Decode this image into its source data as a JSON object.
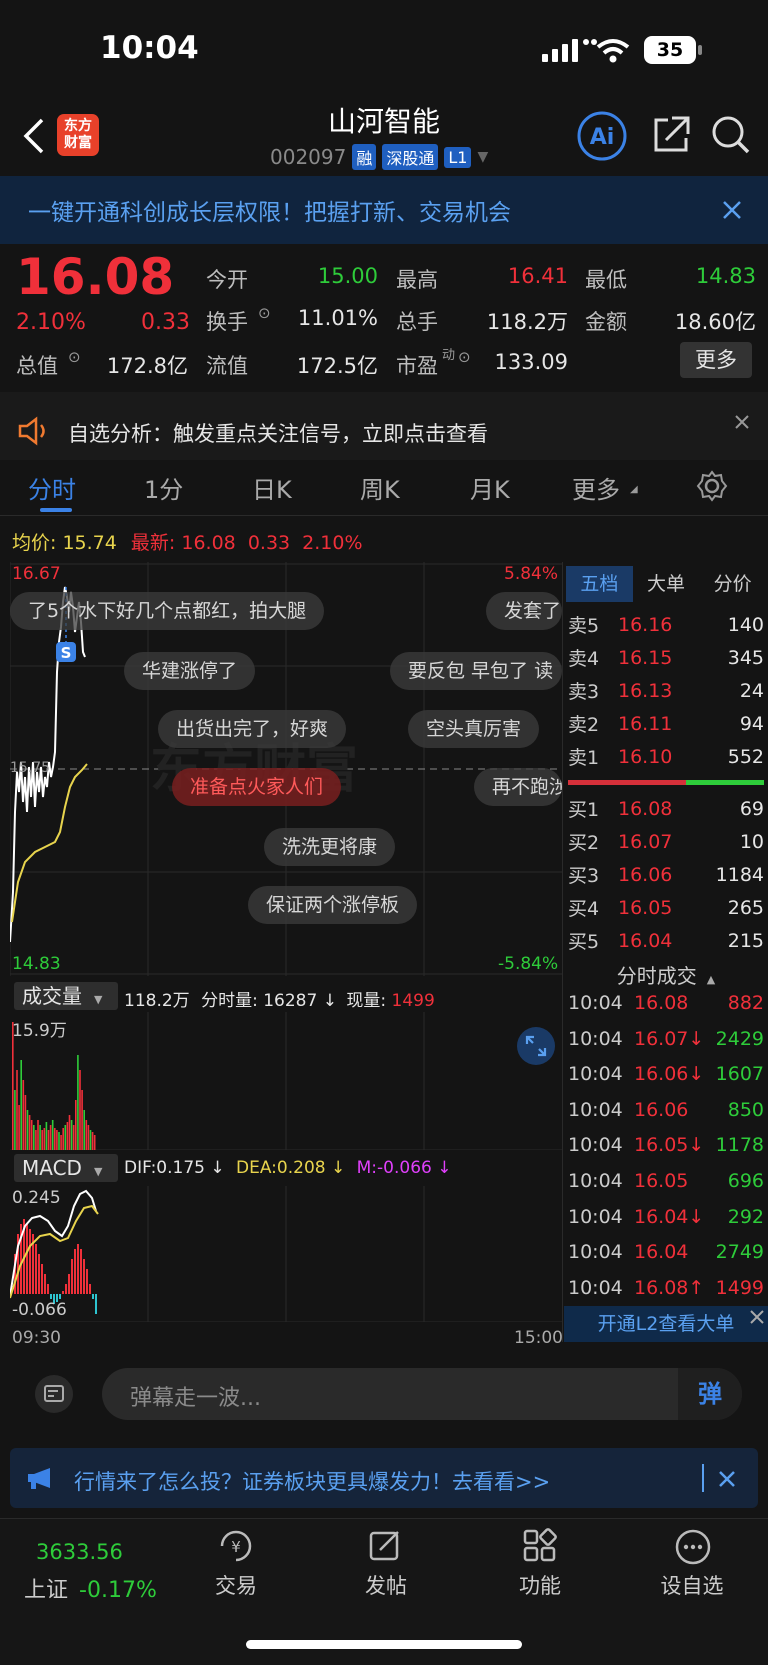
{
  "status": {
    "time": "10:04",
    "battery": "35"
  },
  "header": {
    "logo_line1": "东方",
    "logo_line2": "财富",
    "title": "山河智能",
    "code": "002097",
    "tags": [
      "融",
      "深股通",
      "L1"
    ]
  },
  "banner": {
    "text": "一键开通科创成长层权限！把握打新、交易机会"
  },
  "quote": {
    "price": "16.08",
    "change_pct": "2.10%",
    "change": "0.33",
    "open_label": "今开",
    "open": "15.00",
    "high_label": "最高",
    "high": "16.41",
    "low_label": "最低",
    "low": "14.83",
    "turnover_label": "换手",
    "turnover": "11.01%",
    "volume_label": "总手",
    "volume": "118.2万",
    "amount_label": "金额",
    "amount": "18.60亿",
    "mktcap_label": "总值",
    "mktcap": "172.8亿",
    "float_label": "流值",
    "float": "172.5亿",
    "pe_label": "市盈",
    "pe_sup": "动",
    "pe": "133.09",
    "more": "更多"
  },
  "alert": {
    "text": "自选分析：触发重点关注信号，立即点击查看"
  },
  "tabs": [
    "分时",
    "1分",
    "日K",
    "周K",
    "月K",
    "更多"
  ],
  "chart": {
    "avg_label": "均价:",
    "avg": "15.74",
    "latest_label": "最新:",
    "latest": "16.08",
    "latest_chg": "0.33",
    "latest_pct": "2.10%",
    "y_top": "16.67",
    "y_bottom": "14.83",
    "pct_top": "5.84%",
    "pct_bottom": "-5.84%",
    "mid": "15.75",
    "s_marker": "S",
    "vol_label": "成交量",
    "vol_total": "118.2万",
    "vol_min_label": "分时量:",
    "vol_min": "16287",
    "vol_min_arrow": "↓",
    "vol_now_label": "现量:",
    "vol_now": "1499",
    "vol_top": "15.9万",
    "macd_label": "MACD",
    "dif": "DIF:0.175 ↓",
    "dea": "DEA:0.208 ↓",
    "m": "M:-0.066 ↓",
    "macd_top": "0.245",
    "macd_bottom": "-0.066",
    "x_start": "09:30",
    "x_end": "15:00"
  },
  "bullets": [
    {
      "text": "了5个水下好几个点都红，拍大腿",
      "hot": false
    },
    {
      "text": "发套了",
      "hot": false
    },
    {
      "text": "华建涨停了",
      "hot": false
    },
    {
      "text": "要反包 早包了 读",
      "hot": false
    },
    {
      "text": "出货出完了，好爽",
      "hot": false
    },
    {
      "text": "空头真厉害",
      "hot": false
    },
    {
      "text": "准备点火家人们",
      "hot": true
    },
    {
      "text": "再不跑涉",
      "hot": false
    },
    {
      "text": "洗洗更将康",
      "hot": false
    },
    {
      "text": "保证两个涨停板",
      "hot": false
    }
  ],
  "orderbook": {
    "tabs": [
      "五档",
      "大单",
      "分价"
    ],
    "sell": [
      {
        "label": "卖5",
        "price": "16.16",
        "vol": "140"
      },
      {
        "label": "卖4",
        "price": "16.15",
        "vol": "345"
      },
      {
        "label": "卖3",
        "price": "16.13",
        "vol": "24"
      },
      {
        "label": "卖2",
        "price": "16.11",
        "vol": "94"
      },
      {
        "label": "卖1",
        "price": "16.10",
        "vol": "552"
      }
    ],
    "buy": [
      {
        "label": "买1",
        "price": "16.08",
        "vol": "69"
      },
      {
        "label": "买2",
        "price": "16.07",
        "vol": "10"
      },
      {
        "label": "买3",
        "price": "16.06",
        "vol": "1184"
      },
      {
        "label": "买4",
        "price": "16.05",
        "vol": "265"
      },
      {
        "label": "买5",
        "price": "16.04",
        "vol": "215"
      }
    ]
  },
  "ticks": {
    "header": "分时成交",
    "rows": [
      {
        "time": "10:04",
        "price": "16.08",
        "vol": "882",
        "pc": "red",
        "vc": "red"
      },
      {
        "time": "10:04",
        "price": "16.07↓",
        "vol": "2429",
        "pc": "red",
        "vc": "green"
      },
      {
        "time": "10:04",
        "price": "16.06↓",
        "vol": "1607",
        "pc": "red",
        "vc": "green"
      },
      {
        "time": "10:04",
        "price": "16.06",
        "vol": "850",
        "pc": "red",
        "vc": "green"
      },
      {
        "time": "10:04",
        "price": "16.05↓",
        "vol": "1178",
        "pc": "red",
        "vc": "green"
      },
      {
        "time": "10:04",
        "price": "16.05",
        "vol": "696",
        "pc": "red",
        "vc": "green"
      },
      {
        "time": "10:04",
        "price": "16.04↓",
        "vol": "292",
        "pc": "red",
        "vc": "green"
      },
      {
        "time": "10:04",
        "price": "16.04",
        "vol": "2749",
        "pc": "red",
        "vc": "green"
      },
      {
        "time": "10:04",
        "price": "16.08↑",
        "vol": "1499",
        "pc": "red",
        "vc": "red"
      }
    ],
    "l2_button": "开通L2查看大单"
  },
  "comment": {
    "placeholder": "弹幕走一波...",
    "danmu": "弹"
  },
  "promo": {
    "text": "行情来了怎么投？证券板块更具爆发力！去看看>>"
  },
  "bottom": {
    "index_value": "3633.56",
    "index_name": "上证",
    "index_chg": "-0.17%",
    "items": [
      "交易",
      "发帖",
      "功能",
      "设自选"
    ]
  },
  "colors": {
    "red": "#f0303a",
    "green": "#2ecc3a",
    "blue": "#3b82e6",
    "yellow": "#e8d44d"
  }
}
